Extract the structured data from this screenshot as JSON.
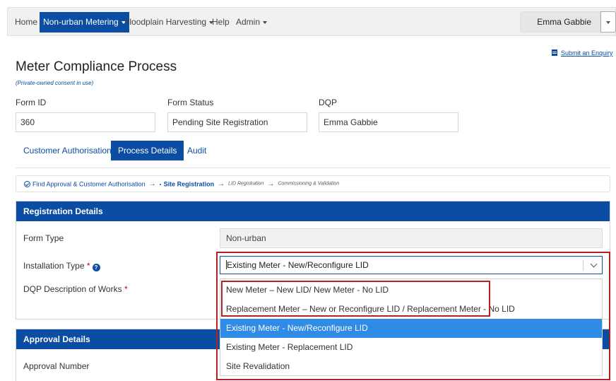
{
  "nav": {
    "home": "Home",
    "non_urban": "Non-urban Metering",
    "floodplain": "Floodplain Harvesting",
    "help": "Help",
    "admin": "Admin",
    "user": "Emma Gabbie"
  },
  "enquiry_link": "Submit an Enquiry",
  "page": {
    "title": "Meter Compliance Process",
    "subtitle": "(Private-owned consent in use)"
  },
  "fields": {
    "form_id": {
      "label": "Form ID",
      "value": "360"
    },
    "form_status": {
      "label": "Form Status",
      "value": "Pending Site Registration"
    },
    "dqp": {
      "label": "DQP",
      "value": "Emma Gabbie"
    }
  },
  "tabs": [
    "Customer Authorisation",
    "Process Details",
    "Audit"
  ],
  "breadcrumb": {
    "step1": "Find Approval & Customer Authorisation",
    "step2": "Site Registration",
    "step3": "LID Registration",
    "step4": "Commissioning & Validation",
    "arrow": "→"
  },
  "registration": {
    "heading": "Registration Details",
    "form_type_label": "Form Type",
    "form_type_value": "Non-urban",
    "installation_label": "Installation Type",
    "required_mark": "*",
    "help_glyph": "?",
    "dqp_works_label": "DQP Description of Works",
    "installation_selected": "Existing Meter - New/Reconfigure LID",
    "options": [
      "New Meter – New LID/ New Meter - No LID",
      "Replacement Meter – New or Reconfigure LID / Replacement Meter - No LID",
      "Existing Meter - New/Reconfigure LID",
      "Existing Meter - Replacement LID",
      "Site Revalidation"
    ]
  },
  "approval": {
    "heading": "Approval Details",
    "approval_number_label": "Approval Number"
  },
  "colors": {
    "primary": "#0a4da2",
    "selected_option": "#2f8be6",
    "annotation": "#b22222"
  }
}
